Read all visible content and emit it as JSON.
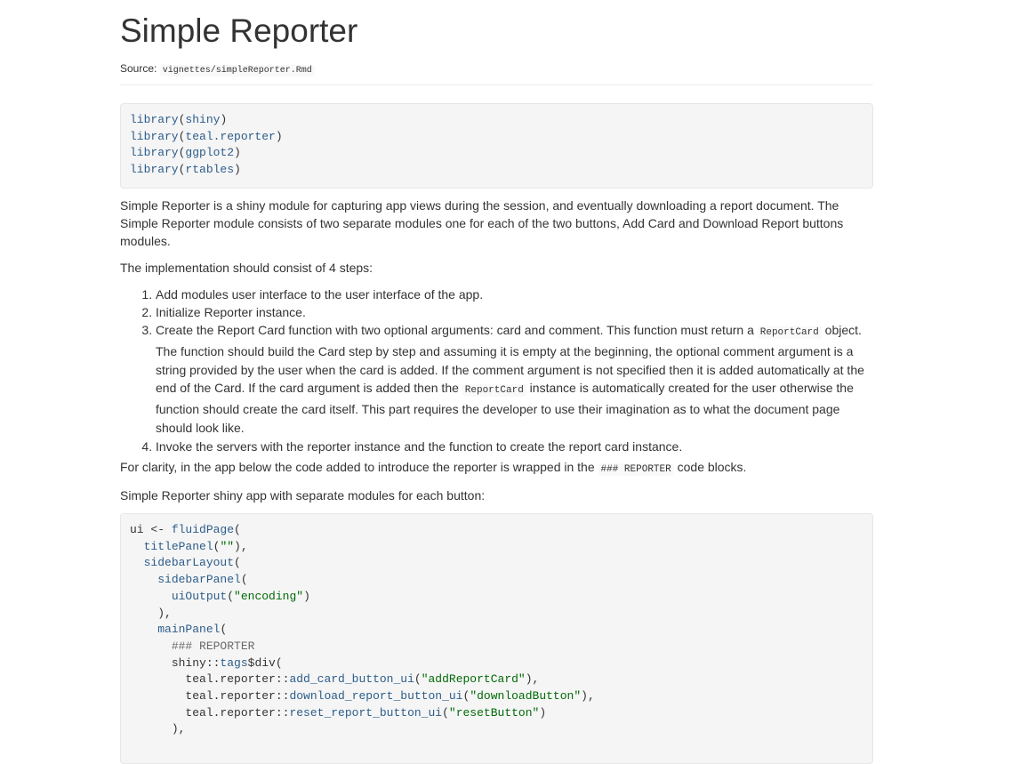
{
  "title": "Simple Reporter",
  "source": {
    "label": "Source:",
    "path": "vignettes/simpleReporter.Rmd"
  },
  "code_setup": [
    {
      "fn": "library",
      "open": "(",
      "arg": "shiny",
      "close": ")"
    },
    {
      "fn": "library",
      "open": "(",
      "arg": "teal.reporter",
      "close": ")"
    },
    {
      "fn": "library",
      "open": "(",
      "arg": "ggplot2",
      "close": ")"
    },
    {
      "fn": "library",
      "open": "(",
      "arg": "rtables",
      "close": ")"
    }
  ],
  "intro": "Simple Reporter is a shiny module for capturing app views during the session, and eventually downloading a report document. The Simple Reporter module consists of two separate modules one for each of the two buttons, Add Card and Download Report buttons modules.",
  "implementation_lead": "The implementation should consist of 4 steps:",
  "steps": {
    "s1": "Add modules user interface to the user interface of the app.",
    "s2": "Initialize Reporter instance.",
    "s3_a": "Create the Report Card function with two optional arguments: card and comment. This function must return a ",
    "s3_code1": "ReportCard",
    "s3_b": " object. The function should build the Card step by step and assuming it is empty at the beginning, the optional comment argument is a string provided by the user when the card is added. If the comment argument is not specified then it is added automatically at the end of the Card. If the card argument is added then the ",
    "s3_code2": "ReportCard",
    "s3_c": " instance is automatically created for the user otherwise the function should create the card itself. This part requires the developer to use their imagination as to what the document page should look like.",
    "s4": "Invoke the servers with the reporter instance and the function to create the report card instance."
  },
  "clarity": {
    "before": "For clarity, in the app below the code added to introduce the reporter is wrapped in the ",
    "code": "### REPORTER",
    "after": " code blocks."
  },
  "app_lead": "Simple Reporter shiny app with separate modules for each button:",
  "code_app": {
    "l1_var": "ui <- ",
    "l1_fn": "fluidPage",
    "l1_rest": "(",
    "l2_fn": "titlePanel",
    "l2_open": "(",
    "l2_str": "\"\"",
    "l2_close": "),",
    "l3_fn": "sidebarLayout",
    "l3_rest": "(",
    "l4_fn": "sidebarPanel",
    "l4_rest": "(",
    "l5_fn": "uiOutput",
    "l5_open": "(",
    "l5_str": "\"encoding\"",
    "l5_close": ")",
    "l6": "),",
    "l7_fn": "mainPanel",
    "l7_rest": "(",
    "l8_comment": "### REPORTER",
    "l9_pkg": "shiny::",
    "l9_fn": "tags",
    "l9_rest": "$div(",
    "l10_pkg": "teal.reporter::",
    "l10_fn": "add_card_button_ui",
    "l10_open": "(",
    "l10_str": "\"addReportCard\"",
    "l10_close": "),",
    "l11_pkg": "teal.reporter::",
    "l11_fn": "download_report_button_ui",
    "l11_open": "(",
    "l11_str": "\"downloadButton\"",
    "l11_close": "),",
    "l12_pkg": "teal.reporter::",
    "l12_fn": "reset_report_button_ui",
    "l12_open": "(",
    "l12_str": "\"resetButton\"",
    "l12_close": ")",
    "l13": "),"
  }
}
